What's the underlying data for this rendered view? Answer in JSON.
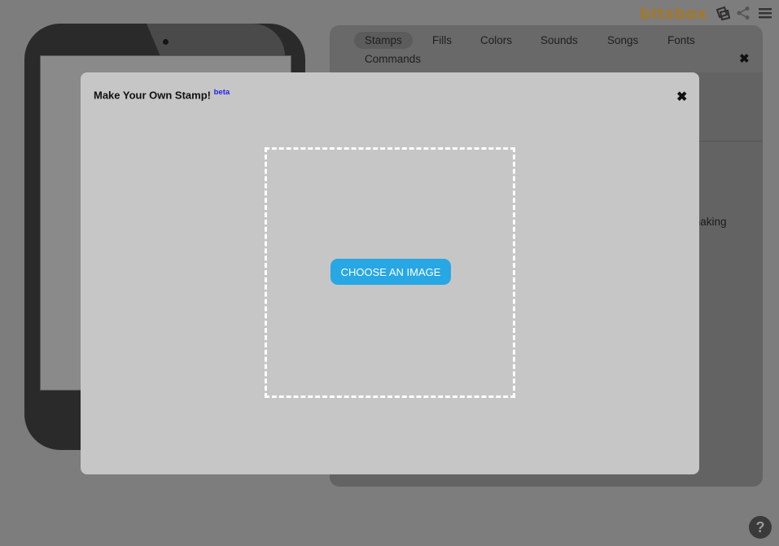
{
  "header": {
    "logo": "bitsbox",
    "icons": [
      "stamps-icon",
      "share-icon",
      "menu-icon"
    ]
  },
  "panel": {
    "tabs": [
      {
        "label": "Stamps",
        "active": true
      },
      {
        "label": "Fills",
        "active": false
      },
      {
        "label": "Colors",
        "active": false
      },
      {
        "label": "Sounds",
        "active": false
      },
      {
        "label": "Songs",
        "active": false
      },
      {
        "label": "Fonts",
        "active": false
      },
      {
        "label": "Commands",
        "active": false
      }
    ],
    "close_label": "✖",
    "partial_text": "making"
  },
  "modal": {
    "title": "Make Your Own Stamp!",
    "badge": "beta",
    "close_label": "✖",
    "choose_button": "CHOOSE AN IMAGE"
  },
  "help": {
    "label": "?"
  },
  "colors": {
    "accent": "#27a7e3",
    "logo": "#a4782a",
    "beta": "#2222ee"
  }
}
